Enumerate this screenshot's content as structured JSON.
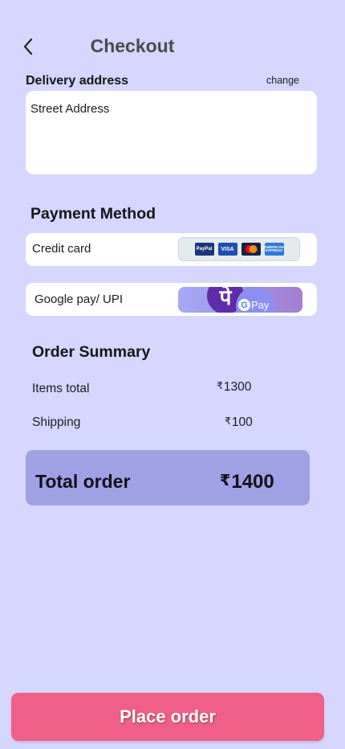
{
  "header": {
    "title": "Checkout",
    "back_icon": "chevron-left-icon"
  },
  "delivery": {
    "label": "Delivery address",
    "change_label": "change",
    "placeholder": "Street Address"
  },
  "payment": {
    "title": "Payment Method",
    "options": [
      {
        "label": "Credit card",
        "logos": [
          "PayPal",
          "VISA",
          "mastercard",
          "AMERICAN EXPRESS"
        ]
      },
      {
        "label": "Google pay/ UPI",
        "logos": [
          "phonepe",
          "G Pay"
        ]
      }
    ],
    "phonepe_glyph": "पे",
    "gpay_g": "G",
    "gpay_text": "Pay"
  },
  "summary": {
    "title": "Order Summary",
    "currency": "₹",
    "rows": [
      {
        "label": "Items total",
        "value": "1300"
      },
      {
        "label": "Shipping",
        "value": "100"
      }
    ],
    "total_label": "Total order",
    "total_value": "1400"
  },
  "actions": {
    "place_order_label": "Place order"
  },
  "colors": {
    "background": "#d6d6fe",
    "accent": "#f05f87",
    "total_bg": "#9ea1e4"
  }
}
